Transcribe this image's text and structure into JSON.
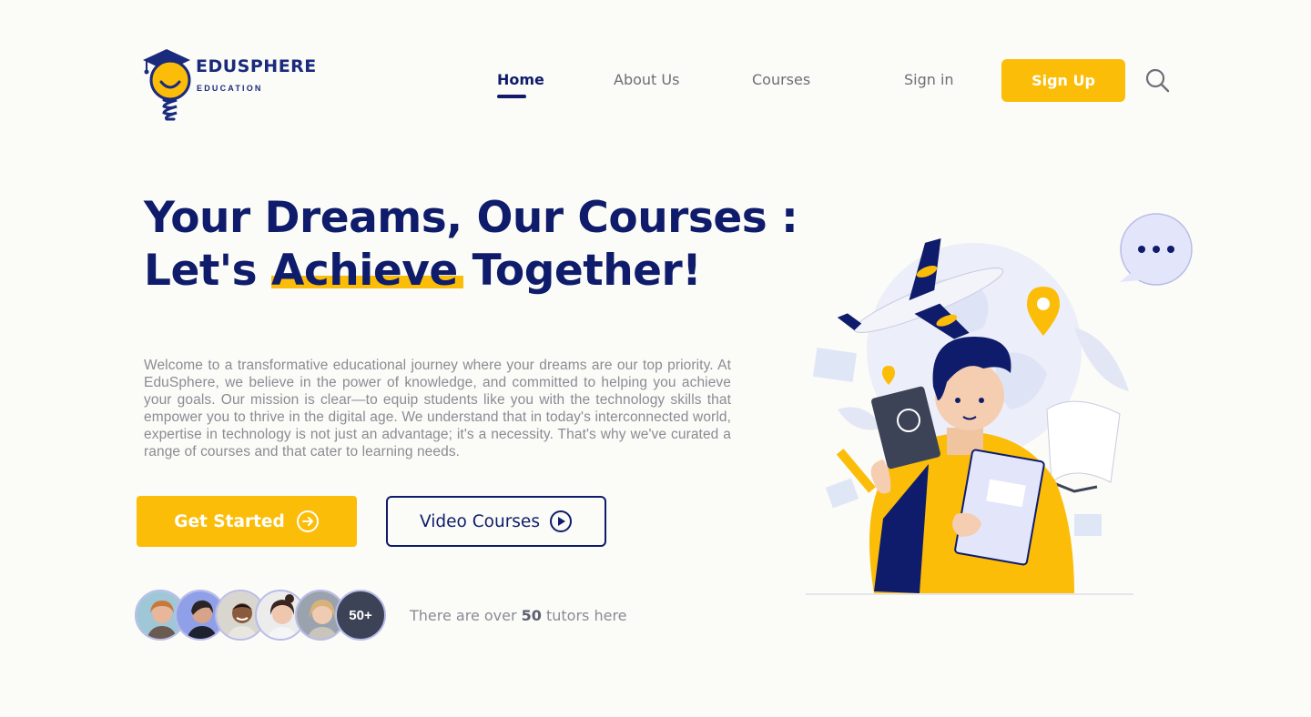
{
  "brand": {
    "name": "EDUSPHERE",
    "tagline": "EDUCATION"
  },
  "nav": {
    "items": [
      {
        "label": "Home",
        "active": true
      },
      {
        "label": "About Us",
        "active": false
      },
      {
        "label": "Courses",
        "active": false
      },
      {
        "label": "Sign in",
        "active": false
      }
    ],
    "signup_label": "Sign Up",
    "search_icon": "search-icon"
  },
  "hero": {
    "line1": "Your Dreams, Our Courses :",
    "line2_before": "Let's ",
    "line2_highlight": "Achieve",
    "line2_after": " Together!",
    "description": "Welcome to a transformative educational journey where your dreams are our top priority. At EduSphere, we believe in the power of knowledge, and committed to helping you achieve your goals. Our mission is clear—to equip students like you with the technology skills that empower you to thrive in the digital age. We understand that in today's interconnected world, expertise in technology is not just an advantage; it's a necessity. That's why we've curated a range of courses and that cater to learning needs.",
    "primary_button": "Get Started",
    "secondary_button": "Video Courses"
  },
  "tutors": {
    "count_badge": "50+",
    "text_before": "There are over ",
    "text_count": "50",
    "text_after": " tutors here"
  },
  "colors": {
    "accent": "#fbbd08",
    "primary": "#0f1c6b",
    "background": "#fbfbf7",
    "muted_text": "#8a8c94"
  }
}
